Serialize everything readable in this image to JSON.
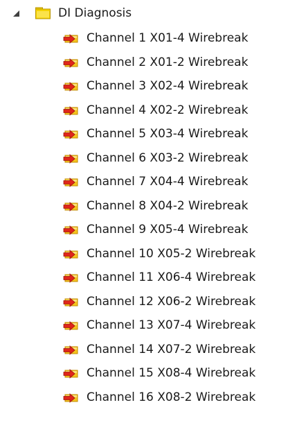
{
  "tree": {
    "root": {
      "label": "DI Diagnosis",
      "expanded": true,
      "expander_icon": "triangle-expanded-icon",
      "icon": "folder-icon",
      "icon_color": "#f5d300"
    },
    "children": [
      {
        "label": "Channel 1 X01-4 Wirebreak",
        "icon": "variable-input-icon"
      },
      {
        "label": "Channel 2 X01-2 Wirebreak",
        "icon": "variable-input-icon"
      },
      {
        "label": "Channel 3 X02-4 Wirebreak",
        "icon": "variable-input-icon"
      },
      {
        "label": "Channel 4 X02-2 Wirebreak",
        "icon": "variable-input-icon"
      },
      {
        "label": "Channel 5 X03-4 Wirebreak",
        "icon": "variable-input-icon"
      },
      {
        "label": "Channel 6 X03-2 Wirebreak",
        "icon": "variable-input-icon"
      },
      {
        "label": "Channel 7 X04-4 Wirebreak",
        "icon": "variable-input-icon"
      },
      {
        "label": "Channel 8 X04-2 Wirebreak",
        "icon": "variable-input-icon"
      },
      {
        "label": "Channel 9 X05-4 Wirebreak",
        "icon": "variable-input-icon"
      },
      {
        "label": "Channel 10 X05-2 Wirebreak",
        "icon": "variable-input-icon"
      },
      {
        "label": "Channel 11 X06-4 Wirebreak",
        "icon": "variable-input-icon"
      },
      {
        "label": "Channel 12 X06-2 Wirebreak",
        "icon": "variable-input-icon"
      },
      {
        "label": "Channel 13 X07-4 Wirebreak",
        "icon": "variable-input-icon"
      },
      {
        "label": "Channel 14 X07-2 Wirebreak",
        "icon": "variable-input-icon"
      },
      {
        "label": "Channel 15 X08-4 Wirebreak",
        "icon": "variable-input-icon"
      },
      {
        "label": "Channel 16 X08-2 Wirebreak",
        "icon": "variable-input-icon"
      }
    ],
    "colors": {
      "text": "#1a1a1a",
      "folder_fill": "#f5d300",
      "folder_border": "#b89400",
      "variable_fill": "#f6c51f",
      "variable_arrow": "#e0261b"
    }
  }
}
